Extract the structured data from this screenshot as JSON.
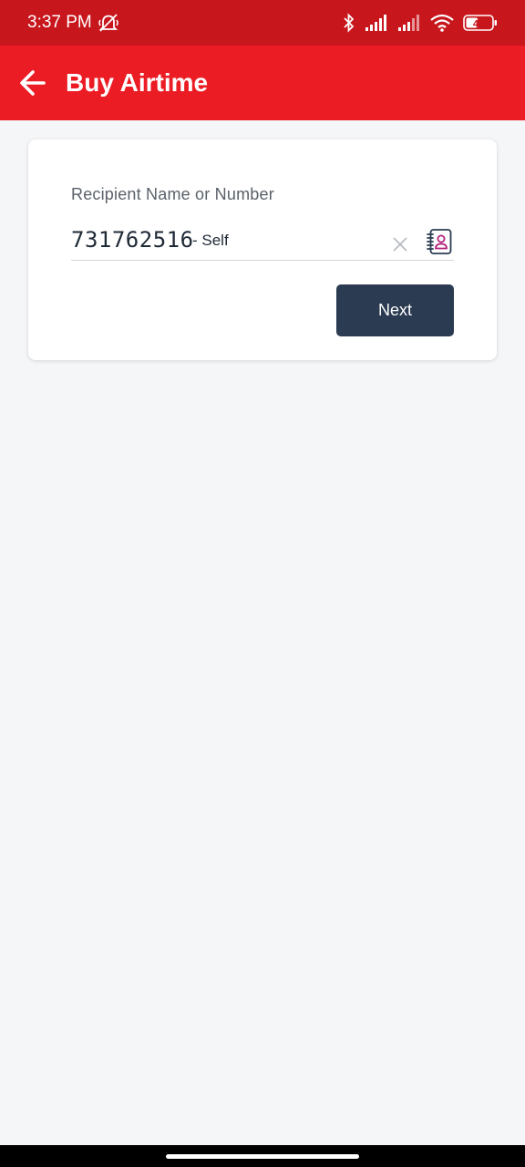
{
  "status_bar": {
    "time": "3:37 PM",
    "battery_level": "45",
    "icons": [
      "muted-bell-icon",
      "bluetooth-icon",
      "signal-icon",
      "signal-icon",
      "wifi-icon",
      "battery-icon"
    ]
  },
  "app_bar": {
    "title": "Buy Airtime",
    "back_icon": "arrow-left-icon",
    "background": "#ec1c24"
  },
  "form": {
    "recipient_label": "Recipient Name or Number",
    "recipient_number": "731762516",
    "recipient_suffix": "- Self",
    "clear_icon": "close-icon",
    "contacts_icon": "contacts-book-icon",
    "next_label": "Next",
    "next_color": "#2b3c52"
  }
}
